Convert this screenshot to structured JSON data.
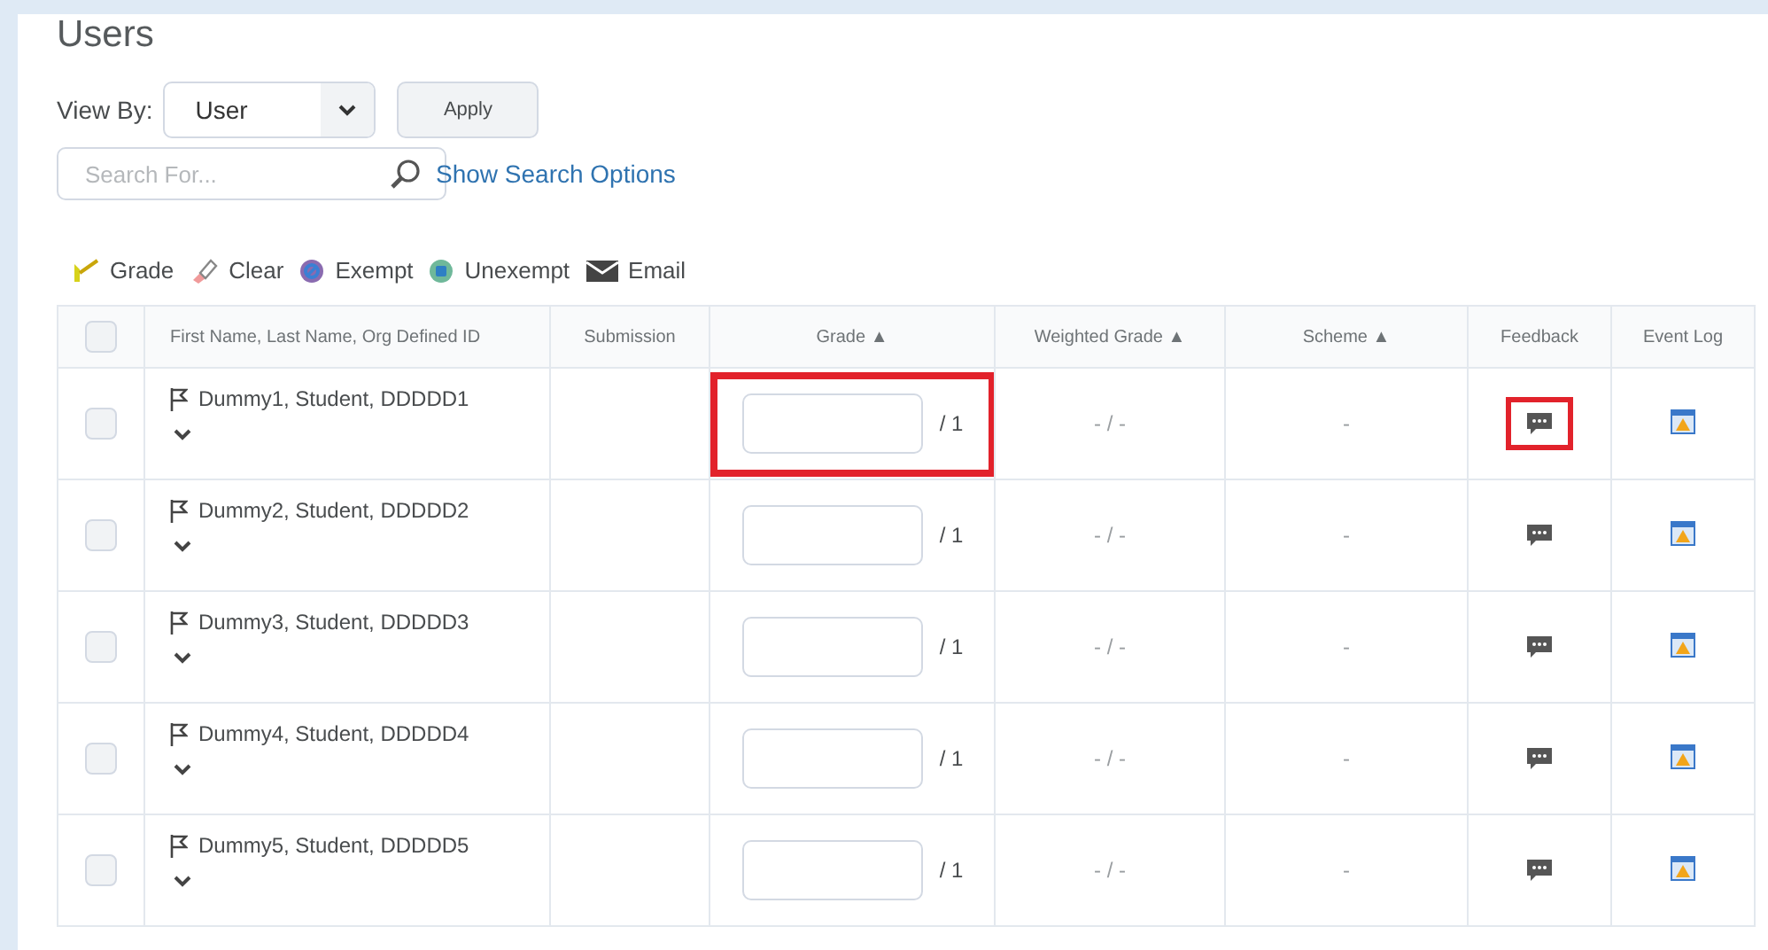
{
  "title": "Users",
  "view_by": {
    "label": "View By:",
    "value": "User",
    "apply": "Apply"
  },
  "search": {
    "placeholder": "Search For...",
    "options_link": "Show Search Options"
  },
  "actions": [
    {
      "kind": "grade",
      "label": "Grade"
    },
    {
      "kind": "clear",
      "label": "Clear"
    },
    {
      "kind": "exempt",
      "label": "Exempt"
    },
    {
      "kind": "unexempt",
      "label": "Unexempt"
    },
    {
      "kind": "email",
      "label": "Email"
    }
  ],
  "table": {
    "select_all_checked": false,
    "columns": [
      "First Name, Last Name, Org Defined ID",
      "Submission",
      "Grade ▲",
      "Weighted Grade ▲",
      "Scheme ▲",
      "Feedback",
      "Event Log"
    ],
    "rows": [
      {
        "checked": false,
        "name": "Dummy1, Student, DDDDD1",
        "out_of": "/ 1",
        "weighted": "- / -",
        "scheme": "-",
        "grade_highlighted": true,
        "feedback_highlighted": true
      },
      {
        "checked": false,
        "name": "Dummy2, Student, DDDDD2",
        "out_of": "/ 1",
        "weighted": "- / -",
        "scheme": "-",
        "grade_highlighted": false,
        "feedback_highlighted": false
      },
      {
        "checked": false,
        "name": "Dummy3, Student, DDDDD3",
        "out_of": "/ 1",
        "weighted": "- / -",
        "scheme": "-",
        "grade_highlighted": false,
        "feedback_highlighted": false
      },
      {
        "checked": false,
        "name": "Dummy4, Student, DDDDD4",
        "out_of": "/ 1",
        "weighted": "- / -",
        "scheme": "-",
        "grade_highlighted": false,
        "feedback_highlighted": false
      },
      {
        "checked": false,
        "name": "Dummy5, Student, DDDDD5",
        "out_of": "/ 1",
        "weighted": "- / -",
        "scheme": "-",
        "grade_highlighted": false,
        "feedback_highlighted": false
      }
    ]
  }
}
